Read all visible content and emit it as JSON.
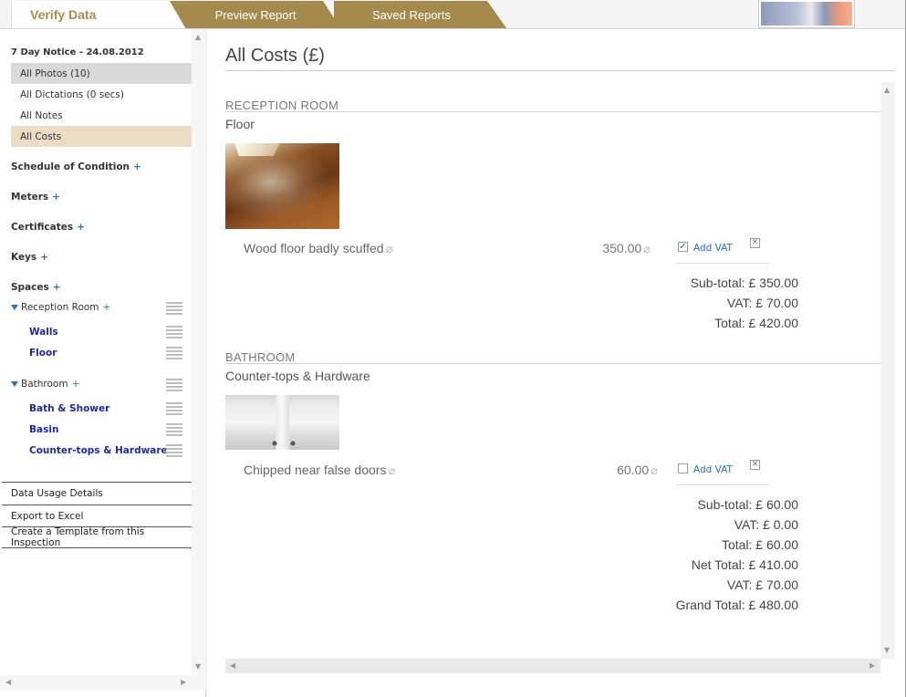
{
  "tabs": {
    "verify": "Verify Data",
    "preview": "Preview Report",
    "saved": "Saved Reports"
  },
  "sidebar": {
    "title": "7 Day Notice - 24.08.2012",
    "items": [
      {
        "label": "All Photos (10)"
      },
      {
        "label": "All Dictations (0 secs)"
      },
      {
        "label": "All Notes"
      },
      {
        "label": "All Costs"
      }
    ],
    "sections": [
      {
        "label": "Schedule of Condition",
        "plus": "+"
      },
      {
        "label": "Meters",
        "plus": "+"
      },
      {
        "label": "Certificates",
        "plus": "+"
      },
      {
        "label": "Keys",
        "plus": "+"
      },
      {
        "label": "Spaces",
        "plus": "+"
      }
    ],
    "spaces": [
      {
        "label": "Reception Room",
        "plus": "+",
        "children": [
          "Walls",
          "Floor"
        ]
      },
      {
        "label": "Bathroom",
        "plus": "+",
        "children": [
          "Bath & Shower",
          "Basin",
          "Counter-tops & Hardware"
        ]
      }
    ],
    "buttons": [
      "Data Usage Details",
      "Export to Excel",
      "Create a Template from this Inspection"
    ]
  },
  "main": {
    "title": "All Costs (£)",
    "rooms": [
      {
        "heading": "RECEPTION ROOM",
        "element": "Floor",
        "cost": {
          "description": "Wood floor badly scuffed",
          "amount": "350.00",
          "vat_label": "Add VAT",
          "vat_checked": true
        },
        "totals": [
          "Sub-total: £ 350.00",
          "VAT: £ 70.00",
          "Total: £ 420.00"
        ]
      },
      {
        "heading": "BATHROOM",
        "element": "Counter-tops & Hardware",
        "cost": {
          "description": "Chipped near false doors",
          "amount": "60.00",
          "vat_label": "Add VAT",
          "vat_checked": false
        },
        "totals": [
          "Sub-total: £ 60.00",
          "VAT: £ 0.00",
          "Total: £ 60.00"
        ]
      }
    ],
    "grand": [
      "Net Total: £ 410.00",
      "VAT: £ 70.00",
      "Grand Total: £ 480.00"
    ]
  },
  "icons": {
    "clip": "paperclip-icon",
    "check": "checkmark-icon",
    "delete": "close-icon",
    "plus": "plus-icon"
  }
}
